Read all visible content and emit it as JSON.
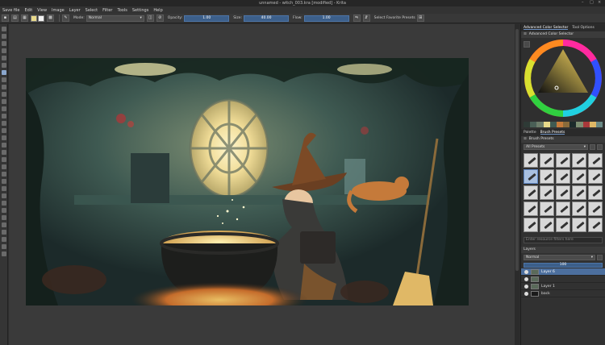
{
  "window": {
    "title": "unnamed - witch_003.kra [modified] - Krita"
  },
  "menu": [
    "Save file",
    "Edit",
    "View",
    "Image",
    "Layer",
    "Select",
    "Filter",
    "Tools",
    "Settings",
    "Help"
  ],
  "toolbar": {
    "mode_label": "Mode:",
    "mode_value": "Normal",
    "opacity_label": "Opacity:",
    "opacity_value": "1.00",
    "size_label": "Size:",
    "size_value": "40.00",
    "flow_label": "Flow:",
    "flow_value": "1.00",
    "favorite_presets": "Select Favorite Presets"
  },
  "dock_tabs": {
    "tab1": "Advanced Color Selector",
    "tab2": "Tool Options"
  },
  "color_selector": {
    "title": "Advanced Color Selector"
  },
  "palette_tabs": {
    "tab1": "Palette",
    "tab2": "Brush Presets"
  },
  "brush_presets": {
    "title": "Brush Presets",
    "filter_value": "All Presets",
    "search_placeholder": "Enter resource filters here"
  },
  "layers": {
    "title": "Layers",
    "blend_mode": "Normal",
    "opacity": "100",
    "items": [
      {
        "name": "Layer 6",
        "selected": true
      },
      {
        "name": "",
        "selected": false
      },
      {
        "name": "Layer 1",
        "selected": false
      },
      {
        "name": "back",
        "selected": false
      },
      {
        "name": "",
        "selected": false
      }
    ]
  },
  "colors": {
    "accent": "#4c6f9e",
    "window_bg": "#2e2e2e",
    "panel_bg": "#313131"
  }
}
